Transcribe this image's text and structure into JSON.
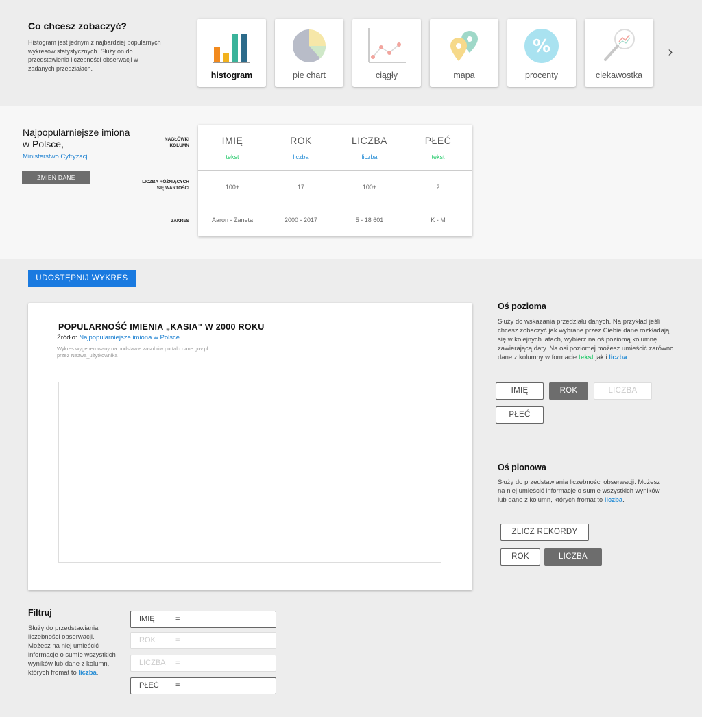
{
  "chart_picker": {
    "title": "Co chcesz zobaczyć?",
    "description": "Histogram jest jednym z najbardziej popularnych wykresów statystycznych. Służy on do przedstawienia liczebności obserwacji w zadanych przedziałach.",
    "types": [
      {
        "label": "histogram",
        "icon": "histogram-icon",
        "active": true
      },
      {
        "label": "pie chart",
        "icon": "pie-chart-icon",
        "active": false
      },
      {
        "label": "ciągły",
        "icon": "line-chart-icon",
        "active": false
      },
      {
        "label": "mapa",
        "icon": "map-pin-icon",
        "active": false
      },
      {
        "label": "procenty",
        "icon": "percent-icon",
        "active": false
      },
      {
        "label": "ciekawostka",
        "icon": "magnifier-icon",
        "active": false
      }
    ],
    "next_icon": "chevron-right-icon"
  },
  "dataset": {
    "title": "Najpopularniejsze imiona w Polsce,",
    "source": "Ministerstwo Cyfryzacji",
    "change_button": "ZMIEŃ DANE",
    "row_labels": {
      "headers": "NAGŁÓWKI KOLUMN",
      "distinct": "LICZBA RÓŻNIĄCYCH SIĘ WARTOŚCI",
      "range": "ZAKRES"
    },
    "columns": [
      {
        "name": "IMIĘ",
        "type": "tekst",
        "distinct": "100+",
        "range": "Aaron - Żaneta"
      },
      {
        "name": "ROK",
        "type": "liczba",
        "distinct": "17",
        "range": "2000 - 2017"
      },
      {
        "name": "LICZBA",
        "type": "liczba",
        "distinct": "100+",
        "range": "5 - 18 601"
      },
      {
        "name": "PŁEĆ",
        "type": "tekst",
        "distinct": "2",
        "range": "K - M"
      }
    ]
  },
  "share_button": "UDOSTĘPNIJ WYKRES",
  "chart": {
    "title": "POPULARNOŚĆ IMIENIA „KASIA\" W 2000 ROKU",
    "source_prefix": "Źródło:",
    "source_link": "Najpopularniejsze imiona w Polsce",
    "generated": "Wykres wygenerowany na podstawie zasobów portalu dane.gov.pl przez Nazwa_użytkownika"
  },
  "x_axis": {
    "title": "Oś pozioma",
    "desc_main": "Służy do wskazania przedziału danych. Na przykład jeśli chcesz zobaczyć jak wybrane przez Ciebie dane rozkładają się w kolejnych latach, wybierz na oś poziomą kolumnę zawierającą daty. Na osi poziomej możesz umieścić zarówno dane z kolumny w formacie",
    "desc_text_kw": "tekst",
    "desc_and": "jak i",
    "desc_num_kw": "liczba",
    "desc_end": ".",
    "buttons": [
      "IMIĘ",
      "ROK",
      "LICZBA",
      "PŁEĆ"
    ]
  },
  "y_axis": {
    "title": "Oś pionowa",
    "desc_main": "Służy do przedstawiania liczebności obserwacji. Możesz na niej umieścić informacje o sumie wszystkich wyników lub dane z kolumn, których fromat to",
    "desc_num_kw": "liczba",
    "desc_end": ".",
    "count_button": "ZLICZ REKORDY",
    "buttons": [
      "ROK",
      "LICZBA"
    ]
  },
  "filter": {
    "title": "Filtruj",
    "desc_main": "Służy do przedstawiania liczebności obserwacji. Możesz na niej umieścić informacje o sumie wszystkich wyników lub dane z kolumn, których fromat to",
    "desc_num_kw": "liczba",
    "desc_end": ".",
    "rows": [
      {
        "name": "IMIĘ",
        "op": "="
      },
      {
        "name": "ROK",
        "op": "="
      },
      {
        "name": "LICZBA",
        "op": "="
      },
      {
        "name": "PŁEĆ",
        "op": "="
      }
    ]
  },
  "colors": {
    "accent_blue": "#1a7ae0",
    "text_type": "#2ecc71",
    "number_type": "#2a8fd6",
    "selected_button": "#6d6d6d"
  }
}
